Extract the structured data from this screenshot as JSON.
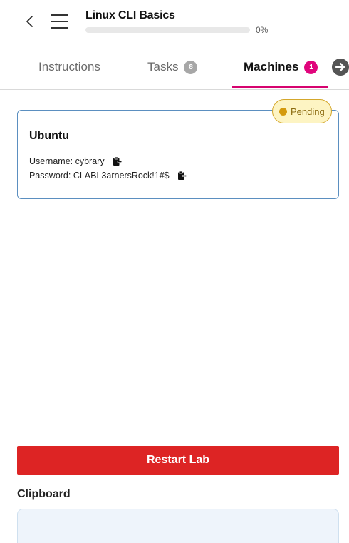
{
  "header": {
    "course_title": "Linux CLI Basics",
    "progress_percent": 0,
    "progress_label": "0%"
  },
  "tabs": [
    {
      "label": "Instructions",
      "badge": null,
      "active": false
    },
    {
      "label": "Tasks",
      "badge": "8",
      "active": false
    },
    {
      "label": "Machines",
      "badge": "1",
      "active": true
    }
  ],
  "machine": {
    "status": "Pending",
    "name": "Ubuntu",
    "username_line": "Username: cybrary",
    "password_line": "Password: CLABL3arnersRock!1#$"
  },
  "actions": {
    "restart_label": "Restart Lab"
  },
  "clipboard": {
    "heading": "Clipboard",
    "value": ""
  },
  "colors": {
    "accent_pink": "#e0057c",
    "restart_red": "#dd2424",
    "pending_amber": "#d49a0e",
    "card_border_blue": "#5b8fc0"
  }
}
